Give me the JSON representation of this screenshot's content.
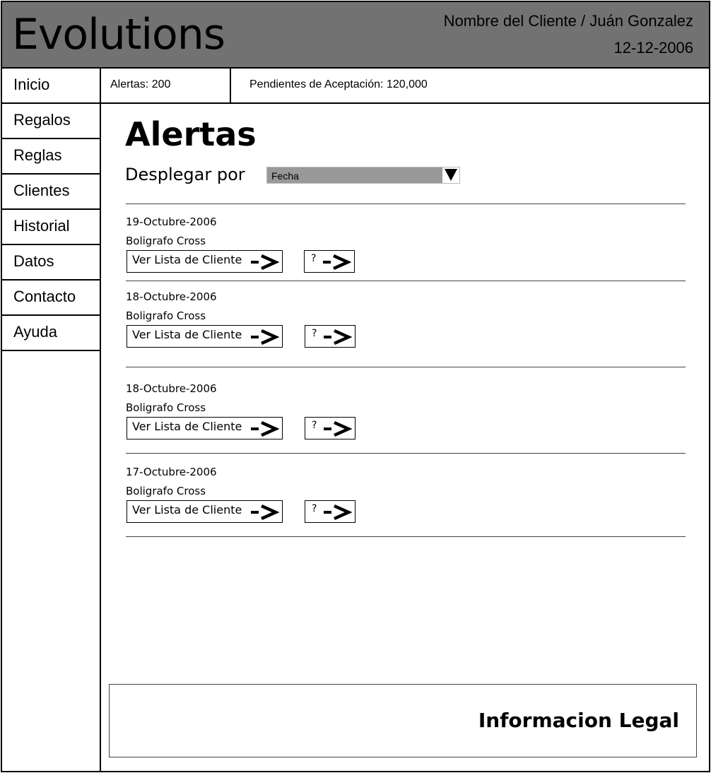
{
  "header": {
    "logo": "Evolutions",
    "client": "Nombre del Cliente / Juán Gonzalez",
    "date": "12-12-2006"
  },
  "nav": {
    "items": [
      "Inicio",
      "Regalos",
      "Reglas",
      "Clientes",
      "Historial",
      "Datos",
      "Contacto",
      "Ayuda"
    ]
  },
  "stats": {
    "alerts": "Alertas: 200",
    "pending": "Pendientes de Aceptación: 120,000"
  },
  "main": {
    "title": "Alertas",
    "sort_label": "Desplegar por",
    "sort_value": "Fecha",
    "alerts": [
      {
        "date": "19-Octubre-2006",
        "item": "Boligrafo Cross",
        "list_label": "Ver Lista de Cliente",
        "help_label": "?"
      },
      {
        "date": "18-Octubre-2006",
        "item": "Boligrafo Cross",
        "list_label": "Ver Lista de Cliente",
        "help_label": "?"
      },
      {
        "date": "18-Octubre-2006",
        "item": "Boligrafo Cross",
        "list_label": "Ver Lista de Cliente",
        "help_label": "?"
      },
      {
        "date": "17-Octubre-2006",
        "item": "Boligrafo Cross",
        "list_label": "Ver Lista de Cliente",
        "help_label": "?"
      }
    ]
  },
  "footer": {
    "legal": "Informacion Legal"
  }
}
